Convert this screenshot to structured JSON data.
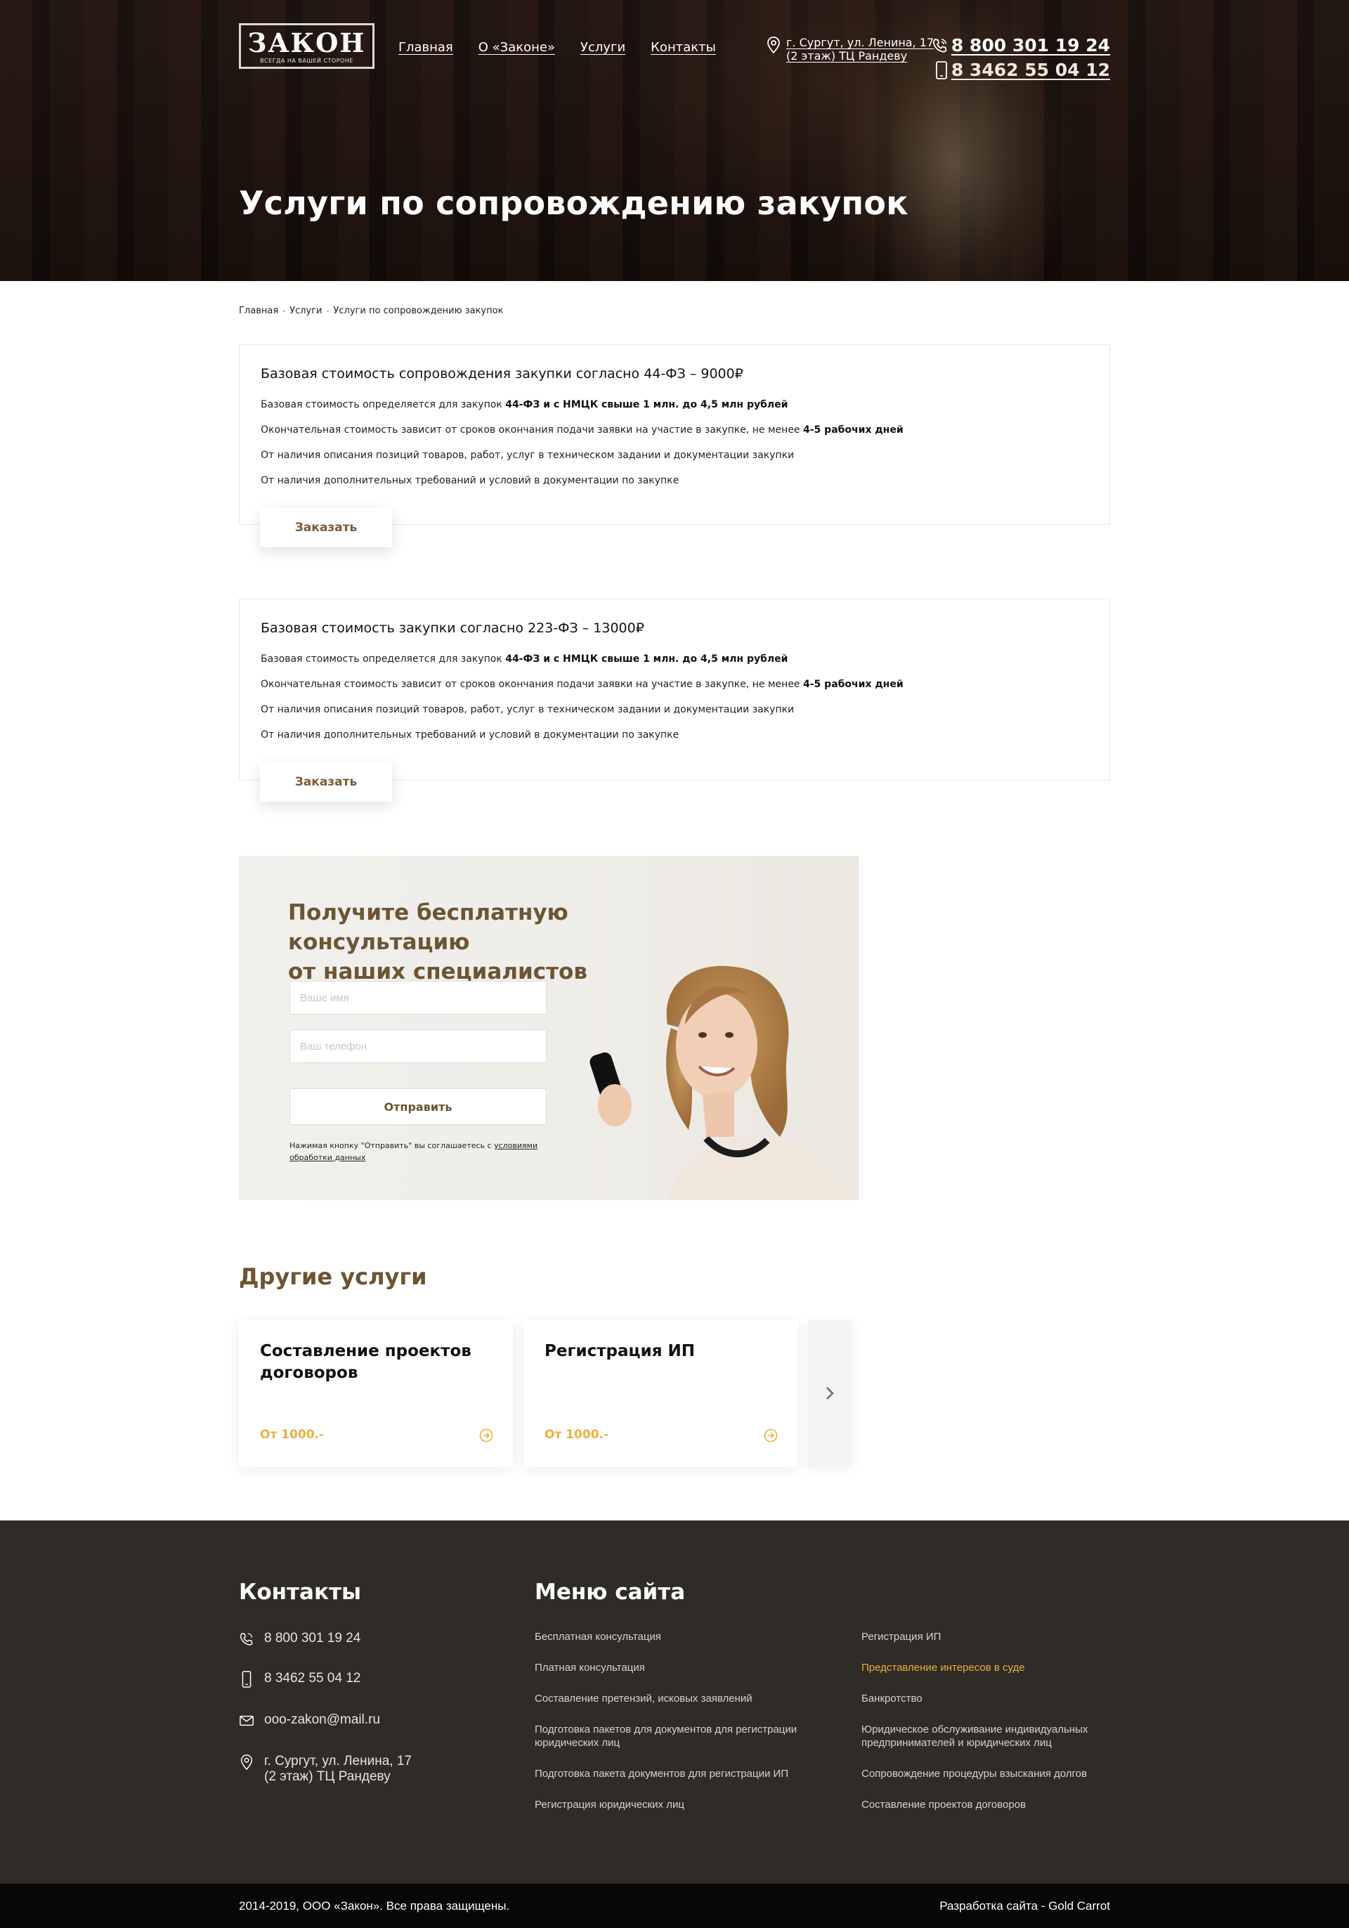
{
  "header": {
    "logo_main": "ЗАКОН",
    "logo_sub": "ВСЕГДА НА ВАШЕЙ СТОРОНЕ",
    "nav": [
      "Главная",
      "О «Законе»",
      "Услуги",
      "Контакты"
    ],
    "address_line1": "г. Сургут, ул. Ленина, 17",
    "address_line2": "(2 этаж) ТЦ Рандеву",
    "phone1": "8 800 301 19 24",
    "phone2": "8 3462 55 04 12",
    "page_title": "Услуги по сопровождению закупок"
  },
  "breadcrumb": [
    "Главная",
    "Услуги",
    "Услуги по сопровождению закупок"
  ],
  "cards": [
    {
      "title": "Базовая стоимость сопровождения закупки согласно 44-ФЗ – 9000₽",
      "line1_a": "Базовая стоимость определяется для закупок ",
      "line1_b": "44-ФЗ и с НМЦК свыше 1 млн. до 4,5 млн рублей",
      "line2_a": "Окончательная стоимость зависит от сроков окончания подачи заявки на участие в закупке, не менее ",
      "line2_b": "4-5 рабочих дней",
      "line3": "От наличия описания позиций товаров, работ, услуг в техническом задании и документации закупки",
      "line4": "От наличия дополнительных требований и условий в документации по закупке",
      "button": "Заказать"
    },
    {
      "title": "Базовая стоимость закупки согласно 223-ФЗ – 13000₽",
      "line1_a": "Базовая стоимость определяется для закупок ",
      "line1_b": "44-ФЗ и с НМЦК свыше 1 млн. до 4,5 млн рублей",
      "line2_a": "Окончательная стоимость зависит от сроков окончания подачи заявки на участие в закупке, не менее ",
      "line2_b": "4-5 рабочих дней",
      "line3": "От наличия описания позиций товаров, работ, услуг в техническом задании и документации закупки",
      "line4": "От наличия дополнительных требований и условий в документации по закупке",
      "button": "Заказать"
    }
  ],
  "consult": {
    "title_line1": "Получите бесплатную консультацию",
    "title_line2": "от наших специалистов",
    "name_placeholder": "Ваше имя",
    "phone_placeholder": "Ваш телефон",
    "send": "Отправить",
    "agree_text": "Нажимая кнопку \"Отправить\" вы соглашаетесь с ",
    "agree_link": "условиями обработки данных"
  },
  "other": {
    "title": "Другие услуги",
    "items": [
      {
        "name": "Составление проектов договоров",
        "price": "От 1000.-"
      },
      {
        "name": "Регистрация ИП",
        "price": "От 1000.-"
      }
    ]
  },
  "footer": {
    "contacts_title": "Контакты",
    "menu_title": "Меню сайта",
    "phone1": "8 800 301 19 24",
    "phone2": "8 3462 55 04 12",
    "email": "ooo-zakon@mail.ru",
    "address_line1": "г. Сургут, ул. Ленина, 17",
    "address_line2": "(2 этаж) ТЦ Рандеву",
    "menu_col1": [
      "Бесплатная консультация",
      "Платная консультация",
      "Составление претензий, исковых заявлений",
      "Подготовка пакетов для документов для регистрации юридических лиц",
      "Подготовка пакета документов для регистрации ИП",
      "Регистрация юридических лиц"
    ],
    "menu_col2": [
      "Регистрация ИП",
      "Представление интересов в суде",
      "Банкротство",
      "Юридическое обслуживание индивидуальных предпринимателей и юридических лиц",
      "Сопровождение процедуры взыскания долгов",
      "Составление проектов договоров"
    ],
    "copyright": "2014-2019, ООО «Закон». Все права защищены.",
    "developer": "Разработка сайта - Gold Carrot"
  },
  "colors": {
    "accent_brown": "#6d5434",
    "accent_gold": "#e8b13e",
    "footer_bg": "#2f2b27"
  },
  "icons": [
    "location-pin-icon",
    "phone-icon",
    "mobile-icon",
    "mail-icon",
    "chevron-right-icon",
    "arrow-circle-icon"
  ]
}
